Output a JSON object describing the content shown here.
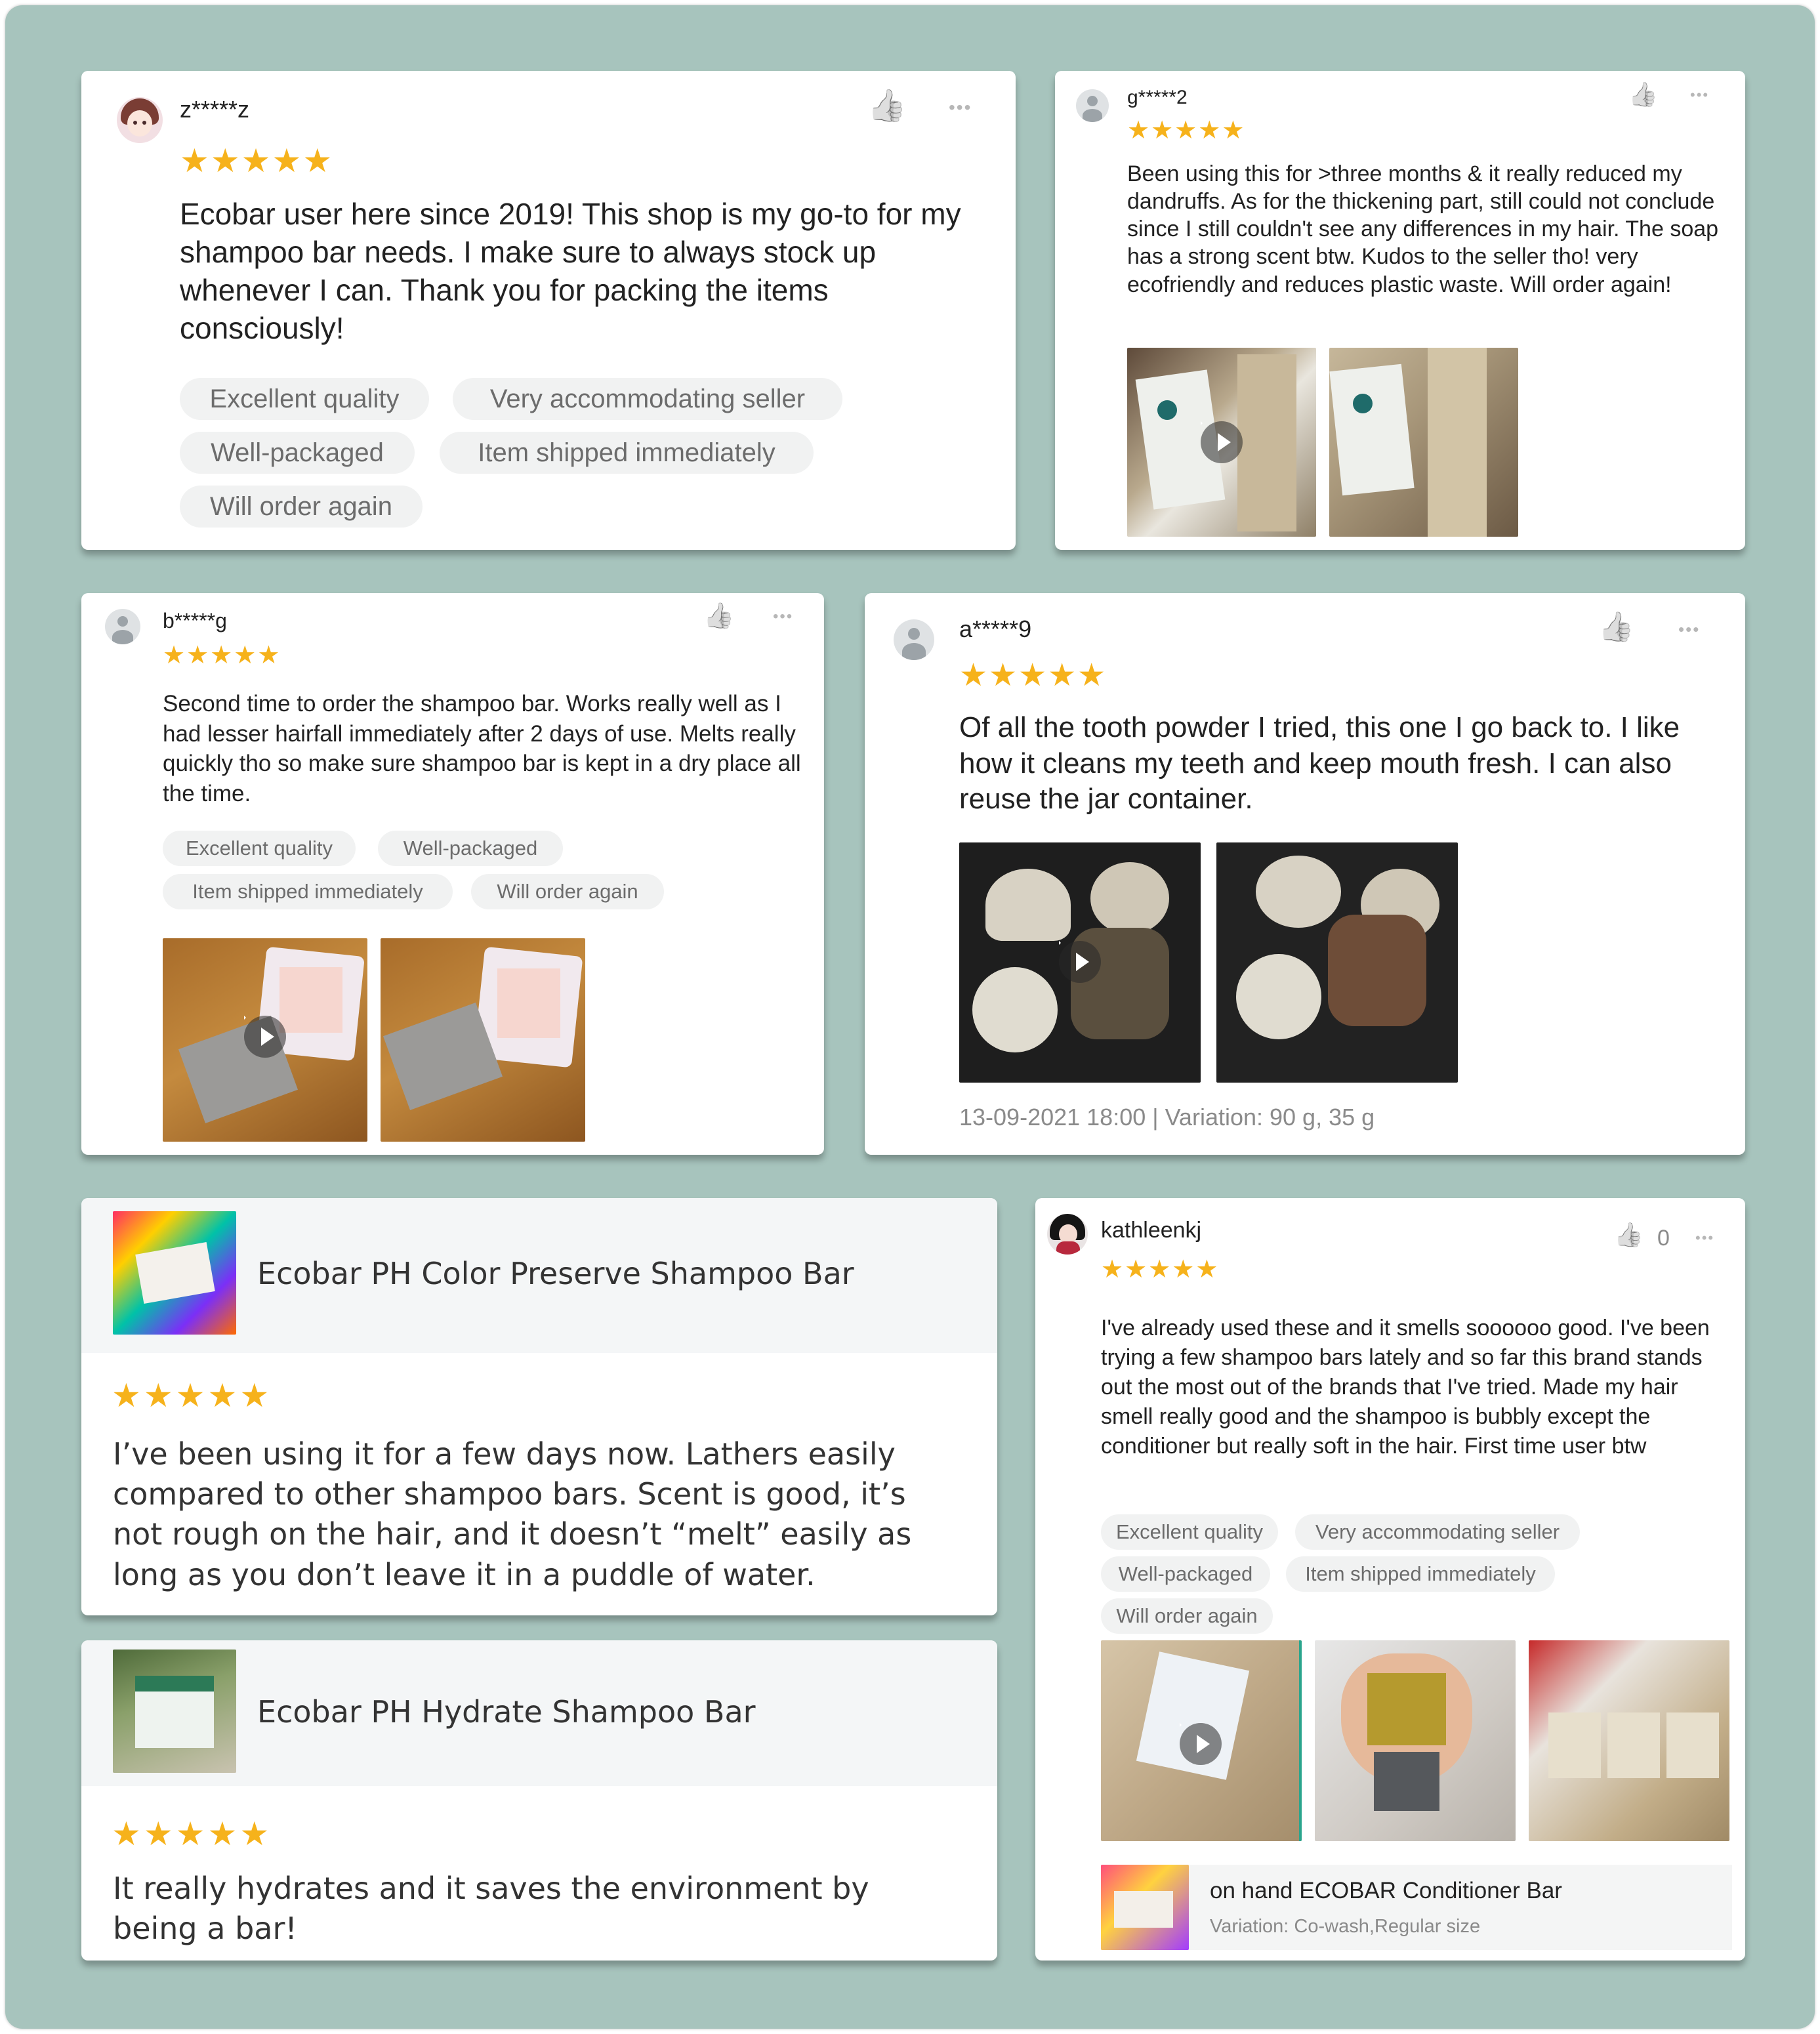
{
  "colors": {
    "background": "#a7c4bd",
    "star": "#f6b21b",
    "card": "#ffffff",
    "tag_bg": "#f1f2f2"
  },
  "icons": {
    "star": "star-icon",
    "like": "thumbs-up-icon",
    "more": "more-options-icon",
    "play": "play-icon",
    "avatar": "user-avatar-icon"
  },
  "star_glyph": "★",
  "like_glyph": "👍",
  "more_glyph": "•••",
  "reviews": [
    {
      "username": "z*****z",
      "rating": 5,
      "text": "Ecobar user here since 2019! This shop is my go-to for my shampoo bar needs. I make sure to always stock up whenever I can. Thank you for packing the items consciously!",
      "tags": [
        "Excellent quality",
        "Very accommodating seller",
        "Well-packaged",
        "Item shipped immediately",
        "Will order again"
      ]
    },
    {
      "username": "g*****2",
      "rating": 5,
      "text": "Been using this for >three months & it really reduced my dandruffs. As for the thickening part, still could not conclude since I still couldn't see any differences in my hair. The soap has a strong scent btw. Kudos to the seller tho! very ecofriendly and reduces plastic waste. Will order again!"
    },
    {
      "username": "b*****g",
      "rating": 5,
      "text": "Second time to order the shampoo bar. Works really well as I had lesser hairfall immediately after 2 days of use. Melts really quickly tho so make sure shampoo bar is kept in a dry place all the time.",
      "tags": [
        "Excellent quality",
        "Well-packaged",
        "Item shipped immediately",
        "Will order again"
      ]
    },
    {
      "username": "a*****9",
      "rating": 5,
      "text": "Of all the tooth powder I tried, this one I go back to. I like how it cleans my teeth and keep mouth  fresh. I can also reuse the jar container.",
      "meta": "13-09-2021 18:00 | Variation: 90 g, 35 g"
    },
    {
      "username": "kathleenkj",
      "rating": 5,
      "likes": "0",
      "text": "I've already used these and it smells soooooo good. I've been trying a few shampoo bars lately and so far this brand stands out the most out of the brands that I've tried. Made my hair smell really good and the shampoo is bubbly except the conditioner but really soft in the hair. First time user btw",
      "tags": [
        "Excellent quality",
        "Very accommodating seller",
        "Well-packaged",
        "Item shipped immediately",
        "Will order again"
      ],
      "product": {
        "name": "on hand ECOBAR Conditioner Bar",
        "variation": "Variation: Co-wash,Regular size"
      }
    }
  ],
  "product_reviews": [
    {
      "product": "Ecobar PH Color Preserve Shampoo Bar",
      "rating": 5,
      "text": "I’ve been using it for a few days now. Lathers easily compared to other shampoo bars. Scent is good, it’s not rough on the hair, and it doesn’t “melt” easily as long as you don’t leave it in a puddle of water."
    },
    {
      "product": "Ecobar PH Hydrate Shampoo Bar",
      "rating": 5,
      "text": "It really hydrates and it saves the environment by being a bar!"
    }
  ]
}
